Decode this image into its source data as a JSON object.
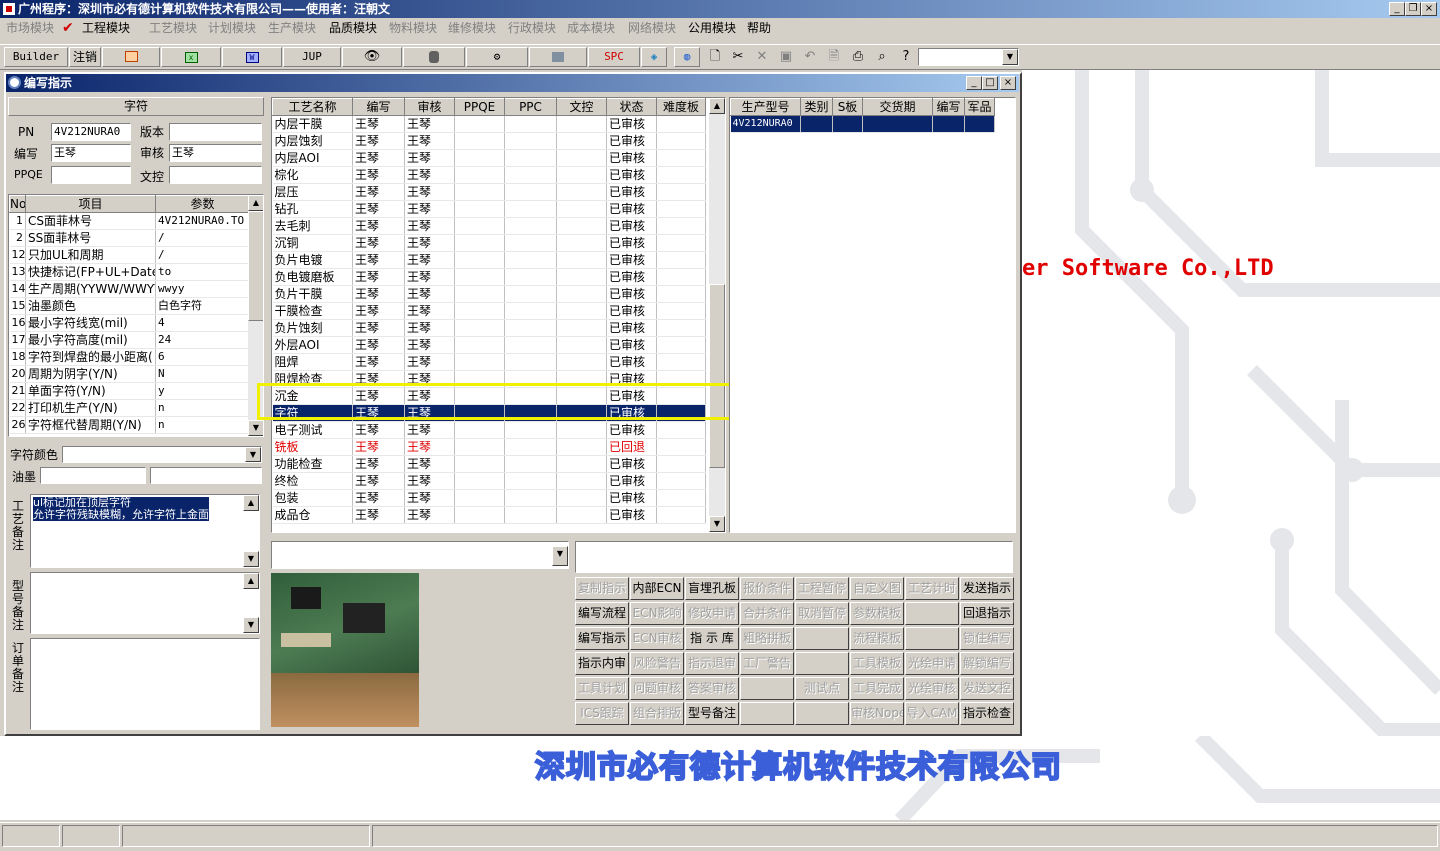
{
  "window": {
    "title": "广州程序：深圳市必有德计算机软件技术有限公司——使用者：汪朝文"
  },
  "menu": {
    "items": [
      {
        "label": "市场模块",
        "enabled": false
      },
      {
        "label": "工程模块",
        "enabled": true
      },
      {
        "label": "工艺模块",
        "enabled": false
      },
      {
        "label": "计划模块",
        "enabled": false
      },
      {
        "label": "生产模块",
        "enabled": false
      },
      {
        "label": "品质模块",
        "enabled": true
      },
      {
        "label": "物料模块",
        "enabled": false
      },
      {
        "label": "维修模块",
        "enabled": false
      },
      {
        "label": "行政模块",
        "enabled": false
      },
      {
        "label": "成本模块",
        "enabled": false
      },
      {
        "label": "网络模块",
        "enabled": false
      },
      {
        "label": "公用模块",
        "enabled": true
      },
      {
        "label": "帮助",
        "enabled": true
      }
    ]
  },
  "toolbar": {
    "builder": "Builder",
    "logout": "注销",
    "jup": "JUP",
    "spc": "SPC"
  },
  "child": {
    "title": "编写指示"
  },
  "left": {
    "header": "字符",
    "pn_label": "PN",
    "pn_value": "4V212NURA0",
    "version_label": "版本",
    "version_value": "",
    "author_label": "编写",
    "author_value": "王琴",
    "review_label": "审核",
    "review_value": "王琴",
    "ppqe_label": "PPQE",
    "ppqe_value": "",
    "doc_label": "文控",
    "doc_value": "",
    "params_headers": [
      "No",
      "项目",
      "参数"
    ],
    "params": [
      [
        "1",
        "CS面菲林号",
        "4V212NURA0.TO"
      ],
      [
        "2",
        "SS面菲林号",
        "/"
      ],
      [
        "12",
        "只加UL和周期",
        "/"
      ],
      [
        "13",
        "快捷标记(FP+UL+DateCo",
        "to"
      ],
      [
        "14",
        "生产周期(YYWW/WWYY)",
        "wwyy"
      ],
      [
        "15",
        "油墨颜色",
        "白色字符"
      ],
      [
        "16",
        "最小字符线宽(mil)",
        "4"
      ],
      [
        "17",
        "最小字符高度(mil)",
        "24"
      ],
      [
        "18",
        "字符到焊盘的最小距离(",
        "6"
      ],
      [
        "20",
        "周期为阴字(Y/N)",
        "N"
      ],
      [
        "21",
        "单面字符(Y/N)",
        "y"
      ],
      [
        "22",
        "打印机生产(Y/N)",
        "n"
      ],
      [
        "26",
        "字符框代替周期(Y/N)",
        "n"
      ]
    ],
    "char_color_label": "字符颜色",
    "ink_label": "油墨",
    "process_note_label": "工艺备注",
    "process_note": "ul标记加在顶层字符\n允许字符残缺模糊，允许字符上金面",
    "model_note_label": "型号备注",
    "order_note_label": "订单备注"
  },
  "steps": {
    "headers": [
      "工艺名称",
      "编写",
      "审核",
      "PPQE",
      "PPC",
      "文控",
      "状态",
      "难度板"
    ],
    "rows": [
      {
        "name": "内层干膜",
        "author": "王琴",
        "reviewer": "王琴",
        "status": "已审核"
      },
      {
        "name": "内层蚀刻",
        "author": "王琴",
        "reviewer": "王琴",
        "status": "已审核"
      },
      {
        "name": "内层AOI",
        "author": "王琴",
        "reviewer": "王琴",
        "status": "已审核"
      },
      {
        "name": "棕化",
        "author": "王琴",
        "reviewer": "王琴",
        "status": "已审核"
      },
      {
        "name": "层压",
        "author": "王琴",
        "reviewer": "王琴",
        "status": "已审核"
      },
      {
        "name": "钻孔",
        "author": "王琴",
        "reviewer": "王琴",
        "status": "已审核"
      },
      {
        "name": "去毛刺",
        "author": "王琴",
        "reviewer": "王琴",
        "status": "已审核"
      },
      {
        "name": "沉铜",
        "author": "王琴",
        "reviewer": "王琴",
        "status": "已审核"
      },
      {
        "name": "负片电镀",
        "author": "王琴",
        "reviewer": "王琴",
        "status": "已审核"
      },
      {
        "name": "负电镀磨板",
        "author": "王琴",
        "reviewer": "王琴",
        "status": "已审核"
      },
      {
        "name": "负片干膜",
        "author": "王琴",
        "reviewer": "王琴",
        "status": "已审核"
      },
      {
        "name": "干膜检查",
        "author": "王琴",
        "reviewer": "王琴",
        "status": "已审核"
      },
      {
        "name": "负片蚀刻",
        "author": "王琴",
        "reviewer": "王琴",
        "status": "已审核"
      },
      {
        "name": "外层AOI",
        "author": "王琴",
        "reviewer": "王琴",
        "status": "已审核"
      },
      {
        "name": "阻焊",
        "author": "王琴",
        "reviewer": "王琴",
        "status": "已审核"
      },
      {
        "name": "阻焊检查",
        "author": "王琴",
        "reviewer": "王琴",
        "status": "已审核"
      },
      {
        "name": "沉金",
        "author": "王琴",
        "reviewer": "王琴",
        "status": "已审核"
      },
      {
        "name": "字符",
        "author": "王琴",
        "reviewer": "王琴",
        "status": "已审核",
        "selected": true
      },
      {
        "name": "电子测试",
        "author": "王琴",
        "reviewer": "王琴",
        "status": "已审核"
      },
      {
        "name": "铣板",
        "author": "王琴",
        "reviewer": "王琴",
        "status": "已回退",
        "rejected": true
      },
      {
        "name": "功能检查",
        "author": "王琴",
        "reviewer": "王琴",
        "status": "已审核"
      },
      {
        "name": "终检",
        "author": "王琴",
        "reviewer": "王琴",
        "status": "已审核"
      },
      {
        "name": "包装",
        "author": "王琴",
        "reviewer": "王琴",
        "status": "已审核"
      },
      {
        "name": "成品仓",
        "author": "王琴",
        "reviewer": "王琴",
        "status": "已审核"
      }
    ]
  },
  "models": {
    "headers": [
      "生产型号",
      "类别",
      "S板",
      "交货期",
      "编写",
      "军品"
    ],
    "rows": [
      [
        "4V212NURA0",
        "",
        "",
        "",
        "",
        ""
      ]
    ]
  },
  "actions": [
    [
      {
        "label": "复制指示",
        "enabled": false
      },
      {
        "label": "内部ECN",
        "enabled": true
      },
      {
        "label": "盲埋孔板",
        "enabled": true
      },
      {
        "label": "报价条件",
        "enabled": false
      },
      {
        "label": "工程暂停",
        "enabled": false
      },
      {
        "label": "自定义图",
        "enabled": false
      },
      {
        "label": "工艺计时",
        "enabled": false
      },
      {
        "label": "发送指示",
        "enabled": true
      }
    ],
    [
      {
        "label": "编写流程",
        "enabled": true
      },
      {
        "label": "ECN影响",
        "enabled": false
      },
      {
        "label": "修改申请",
        "enabled": false
      },
      {
        "label": "合并条件",
        "enabled": false
      },
      {
        "label": "取消暂停",
        "enabled": false
      },
      {
        "label": "参数模板",
        "enabled": false
      },
      {
        "label": "",
        "enabled": false
      },
      {
        "label": "回退指示",
        "enabled": true
      }
    ],
    [
      {
        "label": "编写指示",
        "enabled": true
      },
      {
        "label": "ECN审核",
        "enabled": false
      },
      {
        "label": "指 示 库",
        "enabled": true
      },
      {
        "label": "粗略拼板",
        "enabled": false
      },
      {
        "label": "",
        "enabled": false
      },
      {
        "label": "流程模板",
        "enabled": false
      },
      {
        "label": "",
        "enabled": false
      },
      {
        "label": "锁住编写",
        "enabled": false
      }
    ],
    [
      {
        "label": "指示内审",
        "enabled": true
      },
      {
        "label": "风险警告",
        "enabled": false
      },
      {
        "label": "指示退审",
        "enabled": false
      },
      {
        "label": "工厂警告",
        "enabled": false
      },
      {
        "label": "",
        "enabled": false
      },
      {
        "label": "工具模板",
        "enabled": false
      },
      {
        "label": "光绘申请",
        "enabled": false
      },
      {
        "label": "解锁编写",
        "enabled": false
      }
    ],
    [
      {
        "label": "工具计划",
        "enabled": false
      },
      {
        "label": "问题审核",
        "enabled": false
      },
      {
        "label": "答案审核",
        "enabled": false
      },
      {
        "label": "",
        "enabled": false
      },
      {
        "label": "测试点",
        "enabled": false
      },
      {
        "label": "工具完成",
        "enabled": false
      },
      {
        "label": "光绘审核",
        "enabled": false
      },
      {
        "label": "发送文控",
        "enabled": false
      }
    ],
    [
      {
        "label": "ICS跟踪",
        "enabled": false
      },
      {
        "label": "组合排版",
        "enabled": false
      },
      {
        "label": "型号备注",
        "enabled": true
      },
      {
        "label": "",
        "enabled": false
      },
      {
        "label": "",
        "enabled": false
      },
      {
        "label": "审核Nope",
        "enabled": false
      },
      {
        "label": "导入CAM",
        "enabled": false
      },
      {
        "label": "指示检查",
        "enabled": true
      }
    ]
  ],
  "background": {
    "slogan_en": "er Software Co.,LTD",
    "slogan_cn": "深圳市必有德计算机软件技术有限公司"
  },
  "colors": {
    "title": "#0a246a",
    "selection": "#0a246a",
    "highlight": "#ffff00",
    "rejected": "#e00000",
    "brand_red": "#e00000",
    "brand_blue": "#3a5fd8"
  }
}
